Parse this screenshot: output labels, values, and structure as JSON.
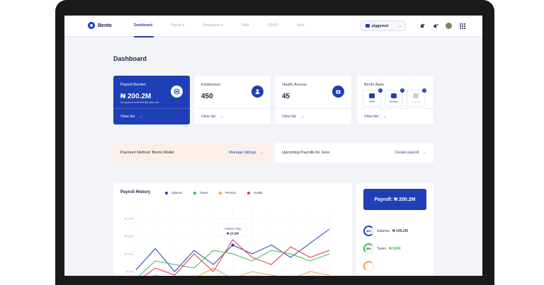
{
  "app": {
    "logo_text": "Bento"
  },
  "nav": [
    {
      "label": "Dashboard"
    },
    {
      "label": "Payroll ▾"
    },
    {
      "label": "Employees ▾"
    },
    {
      "label": "SMA"
    },
    {
      "label": "SSNIT"
    },
    {
      "label": "Vault"
    }
  ],
  "company": {
    "name": "piggyvest",
    "chevron": "⌄"
  },
  "page": {
    "title": "Dashboard"
  },
  "cards": {
    "payroll": {
      "label": "Payroll Burden",
      "value": "₦ 200.2M",
      "sub": "Compared to ₦ 199.5M last mth",
      "link": "View list",
      "arrow": "→"
    },
    "employees": {
      "label": "Employees",
      "value": "450",
      "link": "View list",
      "arrow": "→"
    },
    "health": {
      "label": "Health Access",
      "value": "45",
      "link": "View list",
      "arrow": "→"
    },
    "apps": {
      "label": "Bento Apps",
      "link": "View list",
      "arrow": "→",
      "tiles": [
        {
          "name": "HRM",
          "badge": "+"
        },
        {
          "name": "MyTime",
          "badge": "+"
        },
        {
          "name": "Payroll",
          "badge": "+"
        }
      ]
    }
  },
  "strips": {
    "payment": {
      "label": "Payment Method: Bento Wallet",
      "link": "Manage billings",
      "arrow": "→"
    },
    "upcoming": {
      "label": "Upcoming Payrolls for June",
      "link": "Create payroll",
      "arrow": "→"
    }
  },
  "chart_data": {
    "type": "line",
    "title": "Payroll History",
    "categories": [
      "",
      "",
      "",
      "",
      "",
      "",
      "",
      "",
      "",
      ""
    ],
    "yticks": [
      "₦ 20M",
      "₦ 15M",
      "₦ 10M",
      "₦ 5M"
    ],
    "ylim": [
      0,
      22
    ],
    "series": [
      {
        "name": "Salaries",
        "color": "#1f3fb6",
        "values": [
          5.5,
          11.5,
          5,
          11,
          7,
          12.5,
          10,
          12.5,
          9,
          13,
          17
        ]
      },
      {
        "name": "Taxes",
        "color": "#3dbb52",
        "values": [
          3,
          8,
          7,
          6,
          11,
          10,
          8,
          11,
          10,
          8,
          10
        ]
      },
      {
        "name": "Pension",
        "color": "#f0a24a",
        "values": [
          1,
          4,
          2,
          3,
          6,
          3,
          5,
          4,
          3,
          5,
          4
        ]
      },
      {
        "name": "Health",
        "color": "#d9364a",
        "values": [
          2,
          6,
          4,
          10,
          5,
          14,
          9,
          7,
          12,
          9,
          11
        ]
      }
    ],
    "tooltip": {
      "label": "Salaries May",
      "value": "₦ 10.2M"
    }
  },
  "summary": {
    "payroll_total": "Payroll: ₦ 200.2M",
    "items": [
      {
        "pct": "40%",
        "label": "Salaries",
        "amount": "₦ 199.2M",
        "color": "#1f3fb6"
      },
      {
        "pct": "30%",
        "label": "Taxes",
        "amount": "₦ 500K",
        "color": "#3dbb52"
      },
      {
        "pct": "",
        "label": "",
        "amount": "",
        "color": "#f0a24a"
      }
    ]
  }
}
